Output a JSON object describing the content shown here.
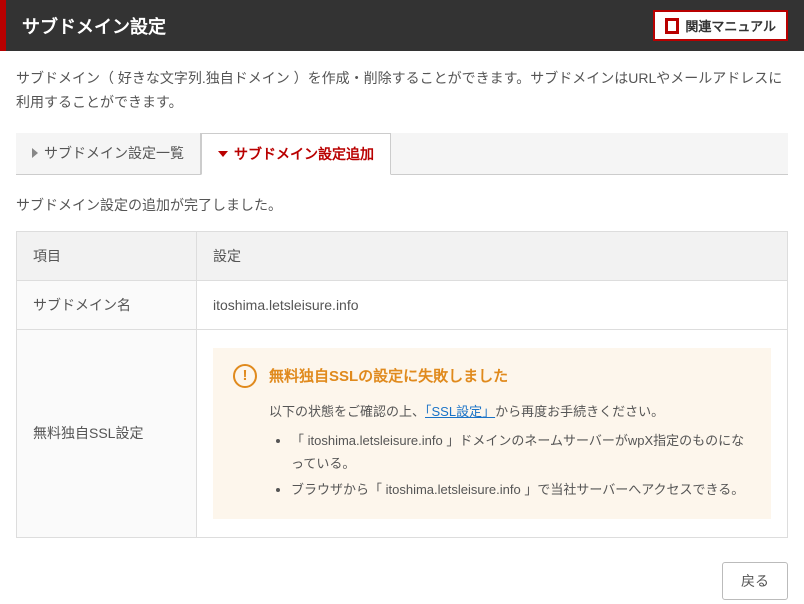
{
  "header": {
    "title": "サブドメイン設定",
    "manual_button": "関連マニュアル"
  },
  "description": "サブドメイン（ 好きな文字列.独自ドメイン ）を作成・削除することができます。サブドメインはURLやメールアドレスに利用することができます。",
  "tabs": {
    "list": "サブドメイン設定一覧",
    "add": "サブドメイン設定追加"
  },
  "status_message": "サブドメイン設定の追加が完了しました。",
  "table": {
    "header_item": "項目",
    "header_setting": "設定",
    "subdomain_label": "サブドメイン名",
    "subdomain_value": "itoshima.letsleisure.info",
    "ssl_label": "無料独自SSL設定"
  },
  "alert": {
    "title": "無料独自SSLの設定に失敗しました",
    "lead_pre": "以下の状態をご確認の上、",
    "lead_link": "「SSL設定」",
    "lead_post": "から再度お手続きください。",
    "bullet1": "「 itoshima.letsleisure.info 」ドメインのネームサーバーがwpX指定のものになっている。",
    "bullet2": "ブラウザから「 itoshima.letsleisure.info 」で当社サーバーへアクセスできる。"
  },
  "footer": {
    "back": "戻る"
  }
}
